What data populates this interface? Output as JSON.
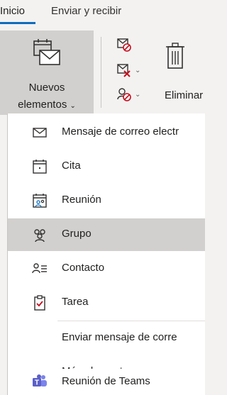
{
  "ribbon": {
    "tabs": [
      {
        "label": "Inicio",
        "active": true
      },
      {
        "label": "Enviar y recibir",
        "active": false
      }
    ],
    "new_items": {
      "line1": "Nuevos",
      "line2": "elementos",
      "chevron": "⌄"
    },
    "delete_label": "Eliminar",
    "icons": [
      "new-items-icon",
      "ignore-icon",
      "clean-up-icon",
      "junk-icon",
      "delete-icon"
    ]
  },
  "menu": {
    "items": [
      {
        "label": "Mensaje de correo electr",
        "icon": "envelope-icon"
      },
      {
        "label": "Cita",
        "icon": "calendar-icon"
      },
      {
        "label": "Reunión",
        "icon": "meeting-icon"
      },
      {
        "label": "Grupo",
        "icon": "group-icon",
        "highlighted": true
      },
      {
        "label": "Contacto",
        "icon": "contact-icon"
      },
      {
        "label": "Tarea",
        "icon": "task-icon"
      },
      {
        "label": "Enviar mensaje de corre",
        "icon": ""
      },
      {
        "label": "Más elementos",
        "icon": ""
      },
      {
        "label": "Reunión de Teams",
        "icon": "teams-icon"
      }
    ]
  },
  "colors": {
    "accent": "#0f6cbd",
    "ribbon_bg": "#f3f2f1",
    "highlight": "#d2d0ce",
    "teams_purple": "#5b5fc7",
    "red_icon": "#c50f1f"
  }
}
